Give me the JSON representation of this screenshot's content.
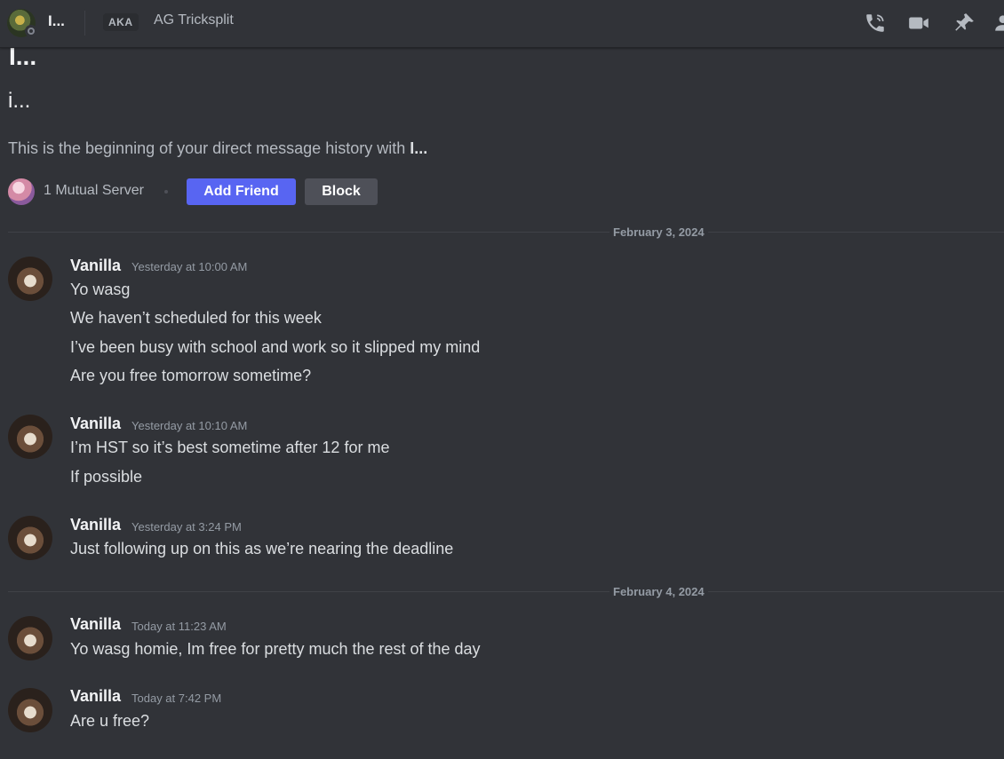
{
  "header": {
    "username": "I...",
    "aka_label": "AKA",
    "aka_name": "AG Tricksplit",
    "icons": [
      "voice-call-icon",
      "video-call-icon",
      "pin-icon",
      "add-friends-to-dm-icon"
    ]
  },
  "intro": {
    "display_name": "I...",
    "username": "i...",
    "text_prefix": "This is the beginning of your direct message history with ",
    "text_name": "I...",
    "mutual_servers": "1 Mutual Server",
    "add_friend_label": "Add Friend",
    "block_label": "Block"
  },
  "dates": [
    "February 3, 2024",
    "February 4, 2024"
  ],
  "messages": [
    {
      "author": "Vanilla",
      "time": "Yesterday at 10:00 AM",
      "lines": [
        "Yo wasg",
        "We haven’t scheduled for this week",
        "I’ve been busy with school and work so it slipped my mind",
        "Are you free tomorrow sometime?"
      ]
    },
    {
      "author": "Vanilla",
      "time": "Yesterday at 10:10 AM",
      "lines": [
        "I’m HST so it’s best sometime after 12 for me",
        "If possible"
      ]
    },
    {
      "author": "Vanilla",
      "time": "Yesterday at 3:24 PM",
      "lines": [
        "Just following up on this as we’re nearing the deadline"
      ]
    },
    {
      "author": "Vanilla",
      "time": "Today at 11:23 AM",
      "lines": [
        "Yo wasg homie, Im free for pretty much the rest of the day"
      ]
    },
    {
      "author": "Vanilla",
      "time": "Today at 7:42 PM",
      "lines": [
        "Are u free?"
      ]
    }
  ]
}
